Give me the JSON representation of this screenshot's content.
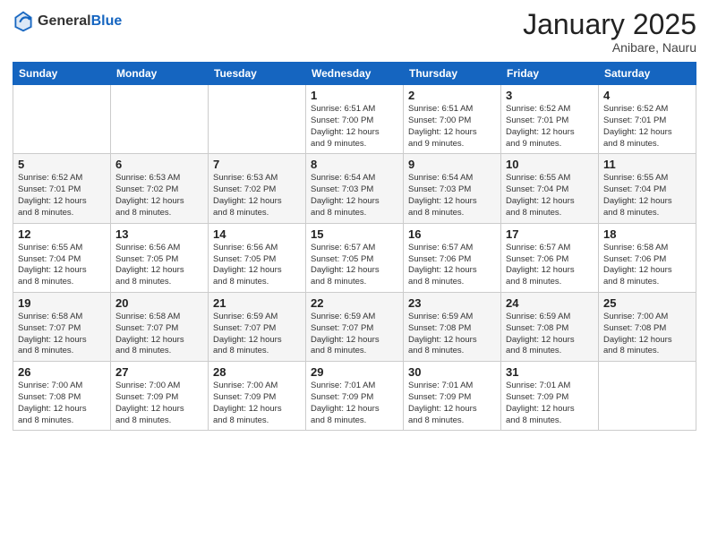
{
  "header": {
    "logo_general": "General",
    "logo_blue": "Blue",
    "month": "January 2025",
    "location": "Anibare, Nauru"
  },
  "weekdays": [
    "Sunday",
    "Monday",
    "Tuesday",
    "Wednesday",
    "Thursday",
    "Friday",
    "Saturday"
  ],
  "weeks": [
    [
      {
        "day": "",
        "info": ""
      },
      {
        "day": "",
        "info": ""
      },
      {
        "day": "",
        "info": ""
      },
      {
        "day": "1",
        "info": "Sunrise: 6:51 AM\nSunset: 7:00 PM\nDaylight: 12 hours\nand 9 minutes."
      },
      {
        "day": "2",
        "info": "Sunrise: 6:51 AM\nSunset: 7:00 PM\nDaylight: 12 hours\nand 9 minutes."
      },
      {
        "day": "3",
        "info": "Sunrise: 6:52 AM\nSunset: 7:01 PM\nDaylight: 12 hours\nand 9 minutes."
      },
      {
        "day": "4",
        "info": "Sunrise: 6:52 AM\nSunset: 7:01 PM\nDaylight: 12 hours\nand 8 minutes."
      }
    ],
    [
      {
        "day": "5",
        "info": "Sunrise: 6:52 AM\nSunset: 7:01 PM\nDaylight: 12 hours\nand 8 minutes."
      },
      {
        "day": "6",
        "info": "Sunrise: 6:53 AM\nSunset: 7:02 PM\nDaylight: 12 hours\nand 8 minutes."
      },
      {
        "day": "7",
        "info": "Sunrise: 6:53 AM\nSunset: 7:02 PM\nDaylight: 12 hours\nand 8 minutes."
      },
      {
        "day": "8",
        "info": "Sunrise: 6:54 AM\nSunset: 7:03 PM\nDaylight: 12 hours\nand 8 minutes."
      },
      {
        "day": "9",
        "info": "Sunrise: 6:54 AM\nSunset: 7:03 PM\nDaylight: 12 hours\nand 8 minutes."
      },
      {
        "day": "10",
        "info": "Sunrise: 6:55 AM\nSunset: 7:04 PM\nDaylight: 12 hours\nand 8 minutes."
      },
      {
        "day": "11",
        "info": "Sunrise: 6:55 AM\nSunset: 7:04 PM\nDaylight: 12 hours\nand 8 minutes."
      }
    ],
    [
      {
        "day": "12",
        "info": "Sunrise: 6:55 AM\nSunset: 7:04 PM\nDaylight: 12 hours\nand 8 minutes."
      },
      {
        "day": "13",
        "info": "Sunrise: 6:56 AM\nSunset: 7:05 PM\nDaylight: 12 hours\nand 8 minutes."
      },
      {
        "day": "14",
        "info": "Sunrise: 6:56 AM\nSunset: 7:05 PM\nDaylight: 12 hours\nand 8 minutes."
      },
      {
        "day": "15",
        "info": "Sunrise: 6:57 AM\nSunset: 7:05 PM\nDaylight: 12 hours\nand 8 minutes."
      },
      {
        "day": "16",
        "info": "Sunrise: 6:57 AM\nSunset: 7:06 PM\nDaylight: 12 hours\nand 8 minutes."
      },
      {
        "day": "17",
        "info": "Sunrise: 6:57 AM\nSunset: 7:06 PM\nDaylight: 12 hours\nand 8 minutes."
      },
      {
        "day": "18",
        "info": "Sunrise: 6:58 AM\nSunset: 7:06 PM\nDaylight: 12 hours\nand 8 minutes."
      }
    ],
    [
      {
        "day": "19",
        "info": "Sunrise: 6:58 AM\nSunset: 7:07 PM\nDaylight: 12 hours\nand 8 minutes."
      },
      {
        "day": "20",
        "info": "Sunrise: 6:58 AM\nSunset: 7:07 PM\nDaylight: 12 hours\nand 8 minutes."
      },
      {
        "day": "21",
        "info": "Sunrise: 6:59 AM\nSunset: 7:07 PM\nDaylight: 12 hours\nand 8 minutes."
      },
      {
        "day": "22",
        "info": "Sunrise: 6:59 AM\nSunset: 7:07 PM\nDaylight: 12 hours\nand 8 minutes."
      },
      {
        "day": "23",
        "info": "Sunrise: 6:59 AM\nSunset: 7:08 PM\nDaylight: 12 hours\nand 8 minutes."
      },
      {
        "day": "24",
        "info": "Sunrise: 6:59 AM\nSunset: 7:08 PM\nDaylight: 12 hours\nand 8 minutes."
      },
      {
        "day": "25",
        "info": "Sunrise: 7:00 AM\nSunset: 7:08 PM\nDaylight: 12 hours\nand 8 minutes."
      }
    ],
    [
      {
        "day": "26",
        "info": "Sunrise: 7:00 AM\nSunset: 7:08 PM\nDaylight: 12 hours\nand 8 minutes."
      },
      {
        "day": "27",
        "info": "Sunrise: 7:00 AM\nSunset: 7:09 PM\nDaylight: 12 hours\nand 8 minutes."
      },
      {
        "day": "28",
        "info": "Sunrise: 7:00 AM\nSunset: 7:09 PM\nDaylight: 12 hours\nand 8 minutes."
      },
      {
        "day": "29",
        "info": "Sunrise: 7:01 AM\nSunset: 7:09 PM\nDaylight: 12 hours\nand 8 minutes."
      },
      {
        "day": "30",
        "info": "Sunrise: 7:01 AM\nSunset: 7:09 PM\nDaylight: 12 hours\nand 8 minutes."
      },
      {
        "day": "31",
        "info": "Sunrise: 7:01 AM\nSunset: 7:09 PM\nDaylight: 12 hours\nand 8 minutes."
      },
      {
        "day": "",
        "info": ""
      }
    ]
  ]
}
